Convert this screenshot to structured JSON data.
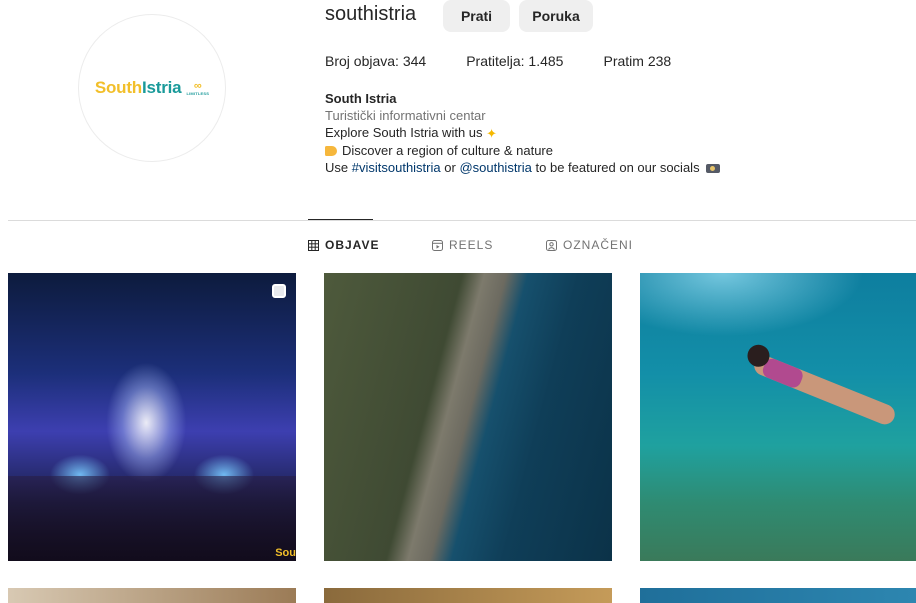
{
  "profile": {
    "username": "southistria",
    "follow_label": "Prati",
    "message_label": "Poruka",
    "logo": {
      "south": "South",
      "istria": "Istria",
      "limitless": "LIMITLESS"
    },
    "stats": {
      "posts": "Broj objava: 344",
      "followers": "Pratitelja: 1.485",
      "following": "Pratim 238"
    },
    "bio": {
      "name": "South Istria",
      "category": "Turistički informativni centar",
      "line1": "Explore South Istria with us",
      "line2": "Discover a region of culture & nature",
      "line3_prefix": "Use",
      "hashtag": "#visitsouthistria",
      "line3_mid": "or",
      "mention": "@southistria",
      "line3_suffix": "to be featured on our socials"
    }
  },
  "tabs": [
    {
      "label": "OBJAVE",
      "active": true,
      "icon": "grid-icon"
    },
    {
      "label": "REELS",
      "active": false,
      "icon": "reels-icon"
    },
    {
      "label": "OZNAČENI",
      "active": false,
      "icon": "tagged-icon"
    }
  ],
  "grid": {
    "watermark": "Sou"
  },
  "colors": {
    "brand_yellow": "#f2bf2a",
    "brand_teal": "#1a9a9a",
    "link": "#00376b"
  }
}
